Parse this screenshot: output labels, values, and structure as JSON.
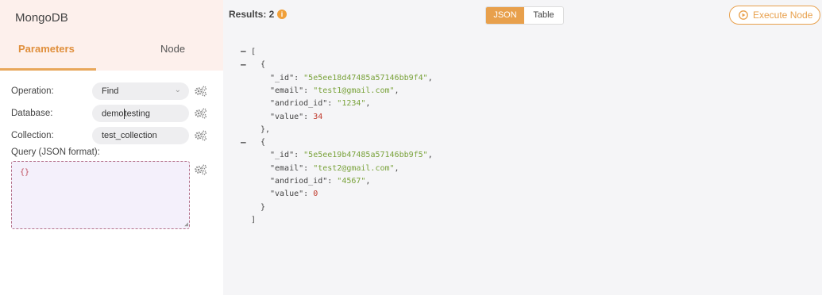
{
  "node": {
    "title": "MongoDB",
    "tabs": [
      "Parameters",
      "Node"
    ]
  },
  "params": {
    "operation_label": "Operation:",
    "operation_value": "Find",
    "database_label": "Database:",
    "database_value_a": "demo",
    "database_value_b": "testing",
    "collection_label": "Collection:",
    "collection_value": "test_collection",
    "query_label": "Query (JSON format):",
    "query_value": "{}"
  },
  "results": {
    "label": "Results: 2",
    "view_options": [
      "JSON",
      "Table"
    ],
    "selected_view": "JSON",
    "execute_label": "Execute Node"
  },
  "json_output": [
    {
      "_id": "5e5ee18d47485a57146bb9f4",
      "email": "test1@gmail.com",
      "andriod_id": "1234",
      "value": "34"
    },
    {
      "_id": "5e5ee19b47485a57146bb9f5",
      "email": "test2@gmail.com",
      "andriod_id": "4567",
      "value": "0"
    }
  ],
  "colors": {
    "accent": "#e8a04c",
    "string": "#79a23a",
    "number": "#c0392b"
  }
}
